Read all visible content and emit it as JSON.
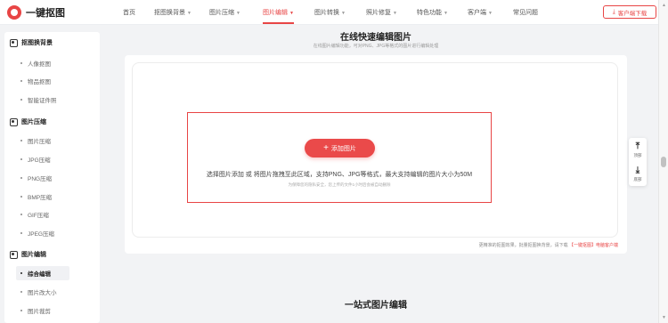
{
  "header": {
    "logo_text": "一键抠图",
    "nav": [
      {
        "label": "首页",
        "has_caret": false,
        "active": false
      },
      {
        "label": "抠图换背景",
        "has_caret": true,
        "active": false
      },
      {
        "label": "图片压缩",
        "has_caret": true,
        "active": false
      },
      {
        "label": "图片编辑",
        "has_caret": true,
        "active": true
      },
      {
        "label": "图片转换",
        "has_caret": true,
        "active": false
      },
      {
        "label": "照片修复",
        "has_caret": true,
        "active": false
      },
      {
        "label": "特色功能",
        "has_caret": true,
        "active": false
      },
      {
        "label": "客户端",
        "has_caret": true,
        "active": false
      },
      {
        "label": "常见问题",
        "has_caret": false,
        "active": false
      }
    ],
    "download_label": "客户端下载",
    "accent_color": "#e84545"
  },
  "sidebar": {
    "groups": [
      {
        "title": "抠图换背景",
        "items": [
          {
            "label": "人像抠图"
          },
          {
            "label": "物品抠图"
          },
          {
            "label": "智能证件照"
          }
        ]
      },
      {
        "title": "图片压缩",
        "items": [
          {
            "label": "图片压缩"
          },
          {
            "label": "JPG压缩"
          },
          {
            "label": "PNG压缩"
          },
          {
            "label": "BMP压缩"
          },
          {
            "label": "GIF压缩"
          },
          {
            "label": "JPEG压缩"
          }
        ]
      },
      {
        "title": "图片编辑",
        "items": [
          {
            "label": "综合编辑",
            "active": true
          },
          {
            "label": "图片改大小"
          },
          {
            "label": "图片裁剪"
          }
        ]
      }
    ]
  },
  "main": {
    "title": "在线快速编辑图片",
    "subtitle": "在线图片编辑功能，可对PNG、JPG等格式的图片进行编辑处理",
    "add_button": "添加图片",
    "drop_hint": "选择图片添加 或 将图片拖拽至此区域，支持PNG、JPG等格式，最大支持编辑的图片大小为50M",
    "drop_note": "为保障您的隐私安全，您上传的文件1小时后会被自动删除",
    "footer_text": "更精准的抠图效果，批量抠图换背景，请下载",
    "footer_link": "【一键抠图】电脑客户端",
    "section_title": "一站式图片编辑"
  },
  "float_bar": {
    "top_label": "顶部",
    "bottom_label": "底部"
  }
}
